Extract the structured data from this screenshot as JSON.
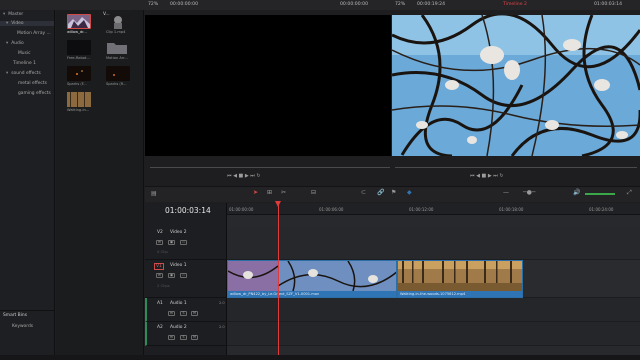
{
  "app": {
    "accent": "#e04646",
    "select_blue": "#2f74b4"
  },
  "bins": {
    "items": [
      {
        "label": "Master",
        "level": 0
      },
      {
        "label": "Video",
        "level": 1,
        "selected": true
      },
      {
        "label": "Motion Array ...",
        "level": 2
      },
      {
        "label": "Audio",
        "level": 1
      },
      {
        "label": "Music",
        "level": 2
      },
      {
        "label": "Timeline 1",
        "level": 2
      },
      {
        "label": "sound effects",
        "level": 1
      },
      {
        "label": "metal effects",
        "level": 2
      },
      {
        "label": "gaming effects",
        "level": 2
      }
    ],
    "smart_bins": "Smart Bins",
    "keywords": "Keywords"
  },
  "pool": {
    "header_label": "V...",
    "clips": [
      {
        "label": "willow_dr...",
        "color": "#6a4c6e"
      },
      {
        "label": "Clip 1.mp4",
        "color": "#5a5a5e"
      },
      {
        "label": "Free-Robot...",
        "color": "#0d0d0f"
      },
      {
        "label": "Motion Arr...",
        "color": "#707076"
      },
      {
        "label": "Sparks (F...",
        "color": "#2a1a12"
      },
      {
        "label": "Sparks (R...",
        "color": "#1d130e"
      },
      {
        "label": "Walking-in...",
        "color": "#7a5a3a"
      }
    ]
  },
  "viewer_source": {
    "zoom": "72%",
    "timecode": "00:00:00:00",
    "right_timecode": "00:00:00:00"
  },
  "viewer_timeline": {
    "zoom": "72%",
    "timecode": "00:00:19:24",
    "timeline_name": "Timeline 2",
    "right_timecode": "01:00:03:14"
  },
  "timeline": {
    "current_timecode": "01:00:03:14",
    "ruler": [
      "01:00:00:00",
      "01:00:06:00",
      "01:00:12:00",
      "01:00:18:00",
      "01:00:24:00"
    ],
    "tracks": [
      {
        "id": "V2",
        "name": "Video 2",
        "clips": "0 Clip"
      },
      {
        "id": "V1",
        "name": "Video 1",
        "clips": "2 Clips"
      },
      {
        "id": "A1",
        "name": "Audio 1",
        "channels": "2.0"
      },
      {
        "id": "A2",
        "name": "Audio 2",
        "channels": "2.0"
      }
    ],
    "video_clips": [
      {
        "name": "willow_dr_PN422_by_Le.Grand_SZF_V1-0001.mov"
      },
      {
        "name": "Walking-in-the-woods-1075612.mp4"
      }
    ]
  }
}
